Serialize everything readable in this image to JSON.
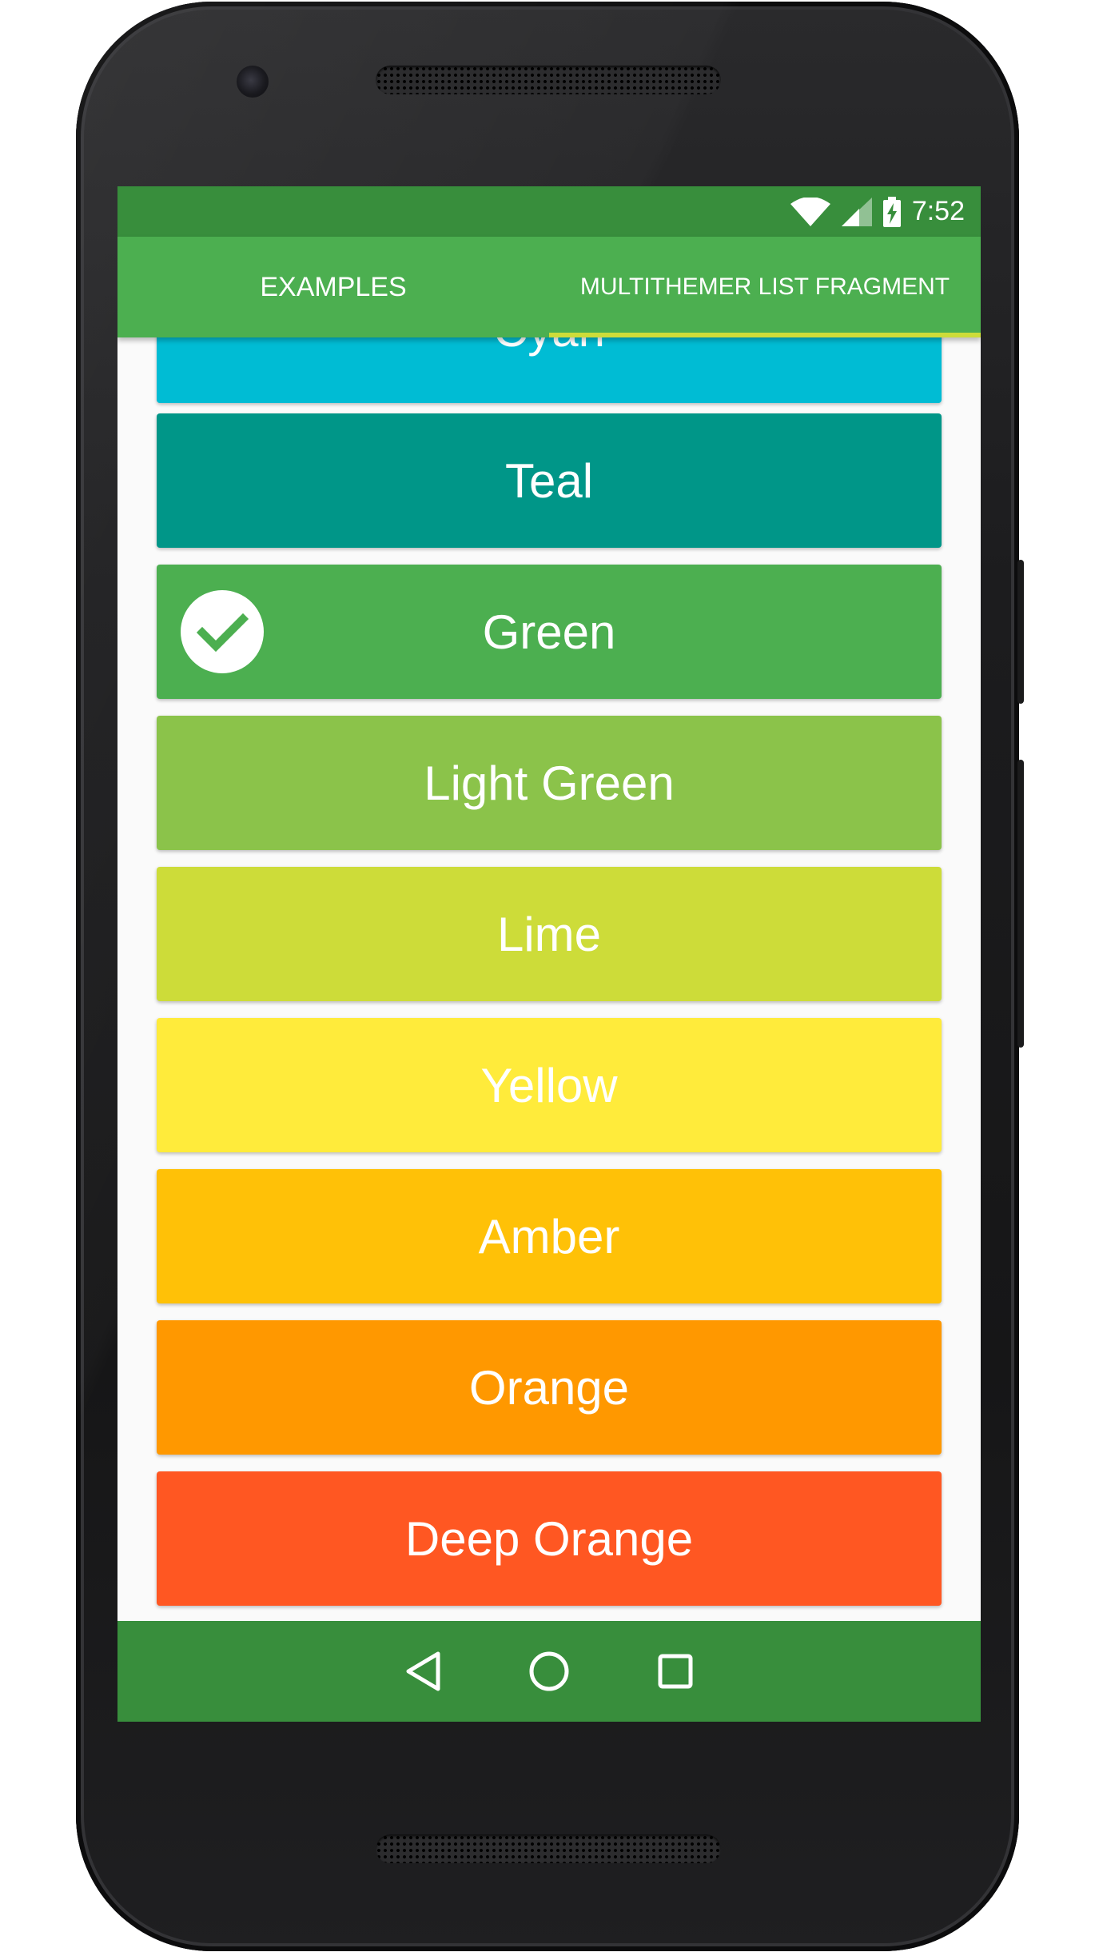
{
  "status_bar": {
    "time": "7:52",
    "icons": [
      "wifi-icon",
      "cell-signal-icon",
      "battery-charging-icon"
    ],
    "color": "#388e3c"
  },
  "app_bar": {
    "color": "#4caf50",
    "tabs": [
      {
        "label": "EXAMPLES",
        "selected": false
      },
      {
        "label": "MULTITHEMER LIST FRAGMENT",
        "selected": true
      }
    ],
    "indicator_color": "#cddc39"
  },
  "color_list": {
    "items": [
      {
        "label": "Cyan",
        "color": "#00bcd4",
        "selected": false
      },
      {
        "label": "Teal",
        "color": "#009688",
        "selected": false
      },
      {
        "label": "Green",
        "color": "#4caf50",
        "selected": true
      },
      {
        "label": "Light Green",
        "color": "#8bc34a",
        "selected": false
      },
      {
        "label": "Lime",
        "color": "#cddc39",
        "selected": false
      },
      {
        "label": "Yellow",
        "color": "#ffeb3b",
        "selected": false
      },
      {
        "label": "Amber",
        "color": "#ffc107",
        "selected": false
      },
      {
        "label": "Orange",
        "color": "#ff9800",
        "selected": false
      },
      {
        "label": "Deep Orange",
        "color": "#ff5722",
        "selected": false
      }
    ],
    "selected_icon": "check-circle-icon"
  },
  "nav_bar": {
    "color": "#388e3c",
    "buttons": [
      "back-icon",
      "home-icon",
      "recents-icon"
    ]
  }
}
